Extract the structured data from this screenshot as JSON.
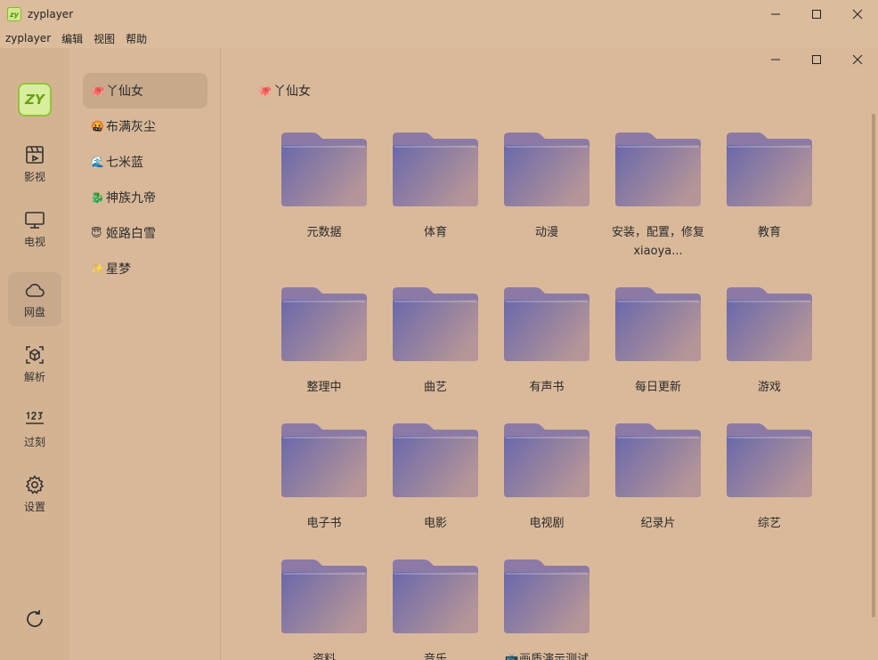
{
  "window": {
    "title": "zyplayer"
  },
  "menu": [
    "zyplayer",
    "编辑",
    "视图",
    "帮助"
  ],
  "logo_text": "ZY",
  "rail": [
    {
      "label": "影视",
      "icon": "film-icon",
      "active": false
    },
    {
      "label": "电视",
      "icon": "tv-icon",
      "active": false
    },
    {
      "label": "网盘",
      "icon": "cloud-icon",
      "active": true
    },
    {
      "label": "解析",
      "icon": "cube-icon",
      "active": false
    },
    {
      "label": "过刻",
      "icon": "number-icon",
      "active": false
    },
    {
      "label": "设置",
      "icon": "gear-icon",
      "active": false
    }
  ],
  "drives": [
    {
      "emoji": "🐙",
      "label": "丫仙女",
      "active": true
    },
    {
      "emoji": "🤬",
      "label": "布满灰尘",
      "active": false
    },
    {
      "emoji": "🌊",
      "label": "七米蓝",
      "active": false
    },
    {
      "emoji": "🐉",
      "label": "神族九帝",
      "active": false
    },
    {
      "emoji": "😇",
      "label": "姬路白雪",
      "active": false
    },
    {
      "emoji": "✨",
      "label": "星梦",
      "active": false
    }
  ],
  "breadcrumb": {
    "emoji": "🐙",
    "label": "丫仙女"
  },
  "folders": [
    "元数据",
    "体育",
    "动漫",
    "安装，配置，修复 xiaoya...",
    "教育",
    "整理中",
    "曲艺",
    "有声书",
    "每日更新",
    "游戏",
    "电子书",
    "电影",
    "电视剧",
    "纪录片",
    "综艺",
    "资料",
    "音乐",
    "📺画质演示测试"
  ],
  "colors": {
    "background": "#d9b99a",
    "folder_front_start": "#6a68ab",
    "folder_front_end": "#b59598",
    "active_item": "#c9a98b"
  }
}
